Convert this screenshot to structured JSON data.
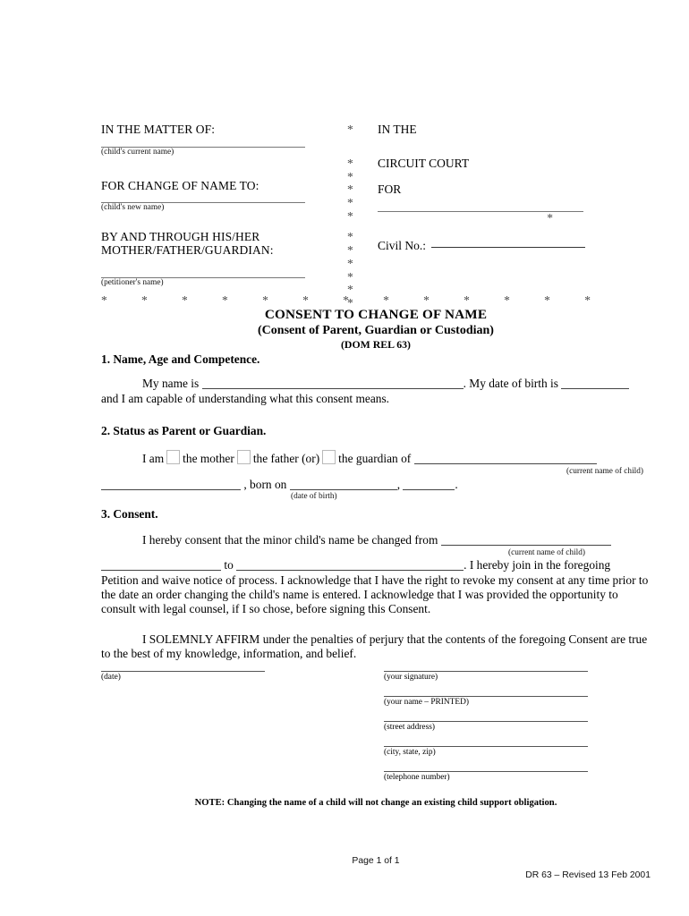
{
  "caption": {
    "left": {
      "matter_of": "IN THE MATTER OF:",
      "child_current_name_label": "(child's current name)",
      "for_change_to": "FOR CHANGE OF NAME TO:",
      "child_new_name_label": "(child's new name)",
      "by_and_through_line1": "BY AND THROUGH HIS/HER",
      "by_and_through_line2": "MOTHER/FATHER/GUARDIAN:",
      "petitioner_name_label": "(petitioner's name)"
    },
    "right": {
      "in_the": "IN THE",
      "circuit_court": "CIRCUIT COURT",
      "for": "FOR",
      "civil_no_label": "Civil No.:"
    },
    "star": "*",
    "separator_stars": [
      "*",
      "*",
      "*",
      "*",
      "*",
      "*",
      "*",
      "*",
      "*",
      "*",
      "*",
      "*",
      "*"
    ]
  },
  "title": {
    "line1": "CONSENT TO CHANGE OF NAME",
    "line2": "(Consent of Parent, Guardian or Custodian)",
    "line3": "(DOM REL 63)"
  },
  "sections": {
    "s1": {
      "heading": "1.  Name, Age and Competence.",
      "t1": "My name is",
      "t2": ".  My date of birth is",
      "t3": "and I am capable of understanding what this consent means."
    },
    "s2": {
      "heading": "2.  Status as Parent or Guardian.",
      "t1": "I am",
      "opt_mother": "the mother",
      "opt_father": "the father (or)",
      "opt_guardian": "the guardian of",
      "current_name_label": "(current name of child)",
      "born_on": ", born on",
      "dob_label": "(date of birth)",
      "comma": ",",
      "period": "."
    },
    "s3": {
      "heading": "3.  Consent.",
      "t1": "I hereby consent that the minor child's name be changed from",
      "current_name_label": "(current name of child)",
      "t2": "to",
      "t3": ".  I hereby join in the foregoing",
      "t4": "Petition and waive notice of process.  I acknowledge that I have the right to revoke my consent at any time prior to the date an order changing the child's name is entered.  I acknowledge that I was provided the opportunity to consult with legal counsel, if I so chose, before signing this Consent."
    },
    "affirm": {
      "bold_lead": "I SOLEMNLY AFFIRM",
      "rest": "under the penalties of perjury that the contents of the foregoing Consent are true to the best of my knowledge, information, and belief."
    }
  },
  "signature": {
    "date_label": "(date)",
    "lines": [
      {
        "label": "(your signature)"
      },
      {
        "label": "(your name – PRINTED)"
      },
      {
        "label": "(street address)"
      },
      {
        "label": "(city, state, zip)"
      },
      {
        "label": "(telephone number)"
      }
    ]
  },
  "note": "NOTE: Changing the name of a child will not change an existing child support obligation.",
  "footer": {
    "page": "Page 1 of 1",
    "form": "DR 63 – Revised 13 Feb 2001"
  }
}
